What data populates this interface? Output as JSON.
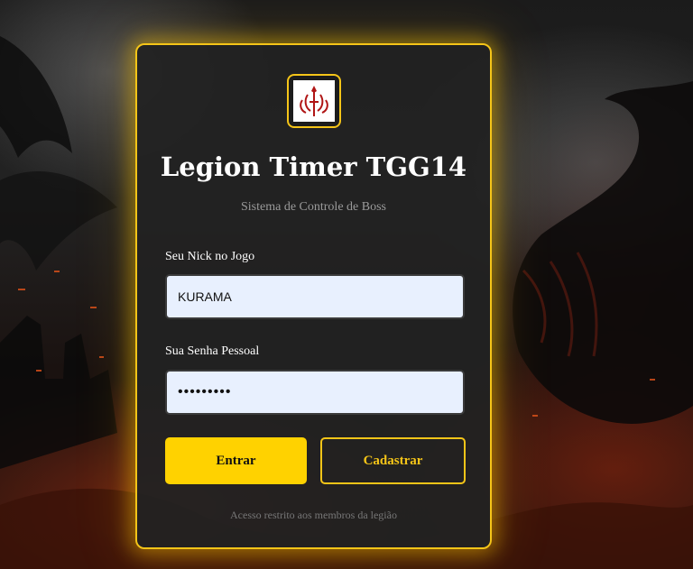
{
  "app": {
    "title": "Legion Timer TGG14",
    "subtitle": "Sistema de Controle de Boss"
  },
  "logo": {
    "icon": "legion-emblem-icon",
    "color": "#b01515"
  },
  "form": {
    "nick_label": "Seu Nick no Jogo",
    "nick_value": "KURAMA",
    "password_label": "Sua Senha Pessoal",
    "password_value": "•••••••••"
  },
  "buttons": {
    "login_label": "Entrar",
    "register_label": "Cadastrar"
  },
  "footer": {
    "note": "Acesso restrito aos membros da legião"
  },
  "theme": {
    "accent": "#f5c518",
    "button_fill": "#ffd200",
    "card_bg": "#222222",
    "input_bg": "#e8f0fe"
  }
}
